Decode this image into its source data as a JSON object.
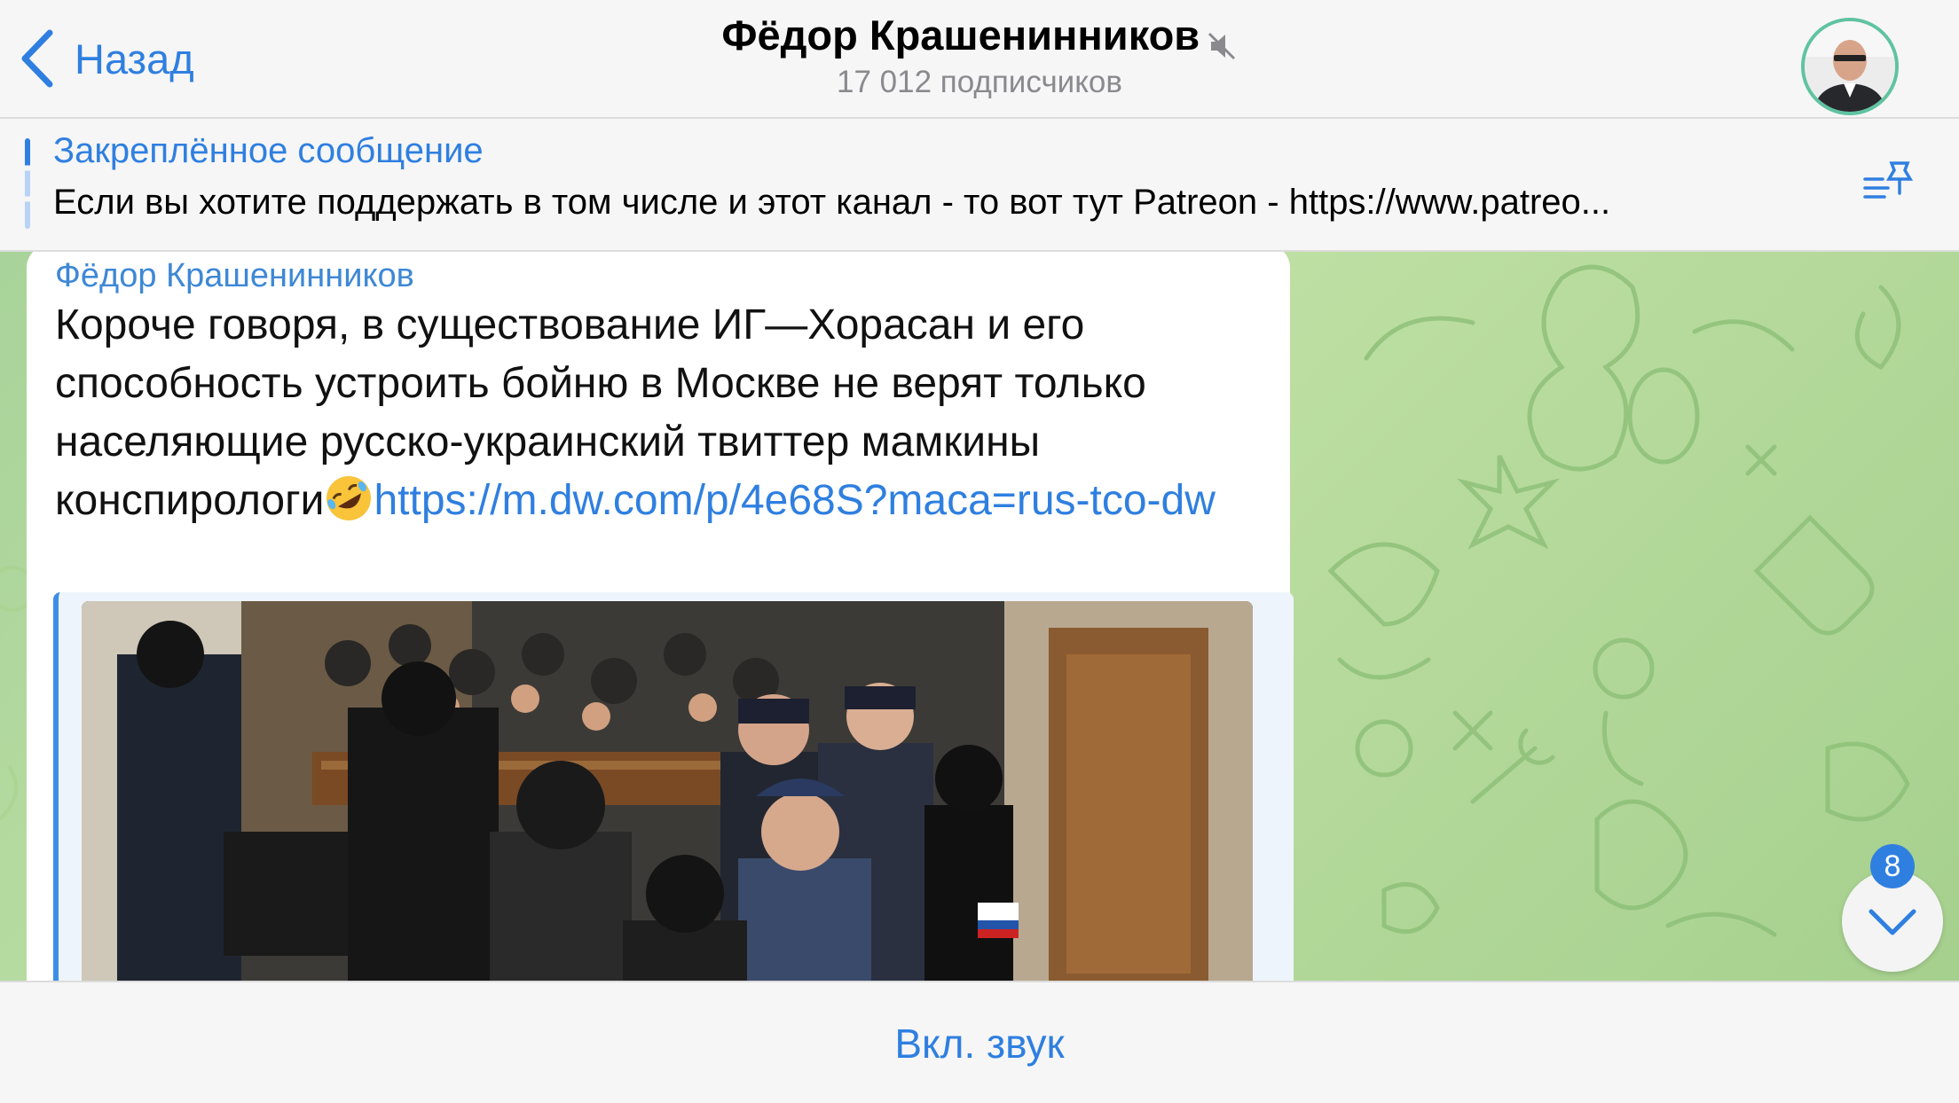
{
  "header": {
    "back_label": "Назад",
    "title": "Фёдор Крашенинников",
    "subscribers": "17 012 подписчиков"
  },
  "pinned": {
    "label": "Закреплённое сообщение",
    "text": "Если вы хотите поддержать в том числе и этот канал - то вот тут Patreon - https://www.patreo..."
  },
  "message": {
    "author": "Фёдор Крашенинников",
    "text": "Короче говоря, в существование ИГ—Хорасан и его способность устроить бойню в Москве не верят только населяющие русско-украинский твиттер мамкины конспирологи",
    "emoji": "rolling-on-floor-laughing",
    "link": "https://m.dw.com/p/4e68S?maca=rus-tco-dw",
    "preview_image": "courtroom-photo"
  },
  "scroll": {
    "unread_count": "8"
  },
  "bottom": {
    "unmute_label": "Вкл. звук"
  },
  "colors": {
    "accent": "#2f7fe0",
    "chat_bg": "#b3d89a",
    "bubble": "#ffffff"
  },
  "icons": [
    "chevron-left-icon",
    "muted-speaker-icon",
    "pin-list-icon",
    "chevron-down-icon"
  ]
}
